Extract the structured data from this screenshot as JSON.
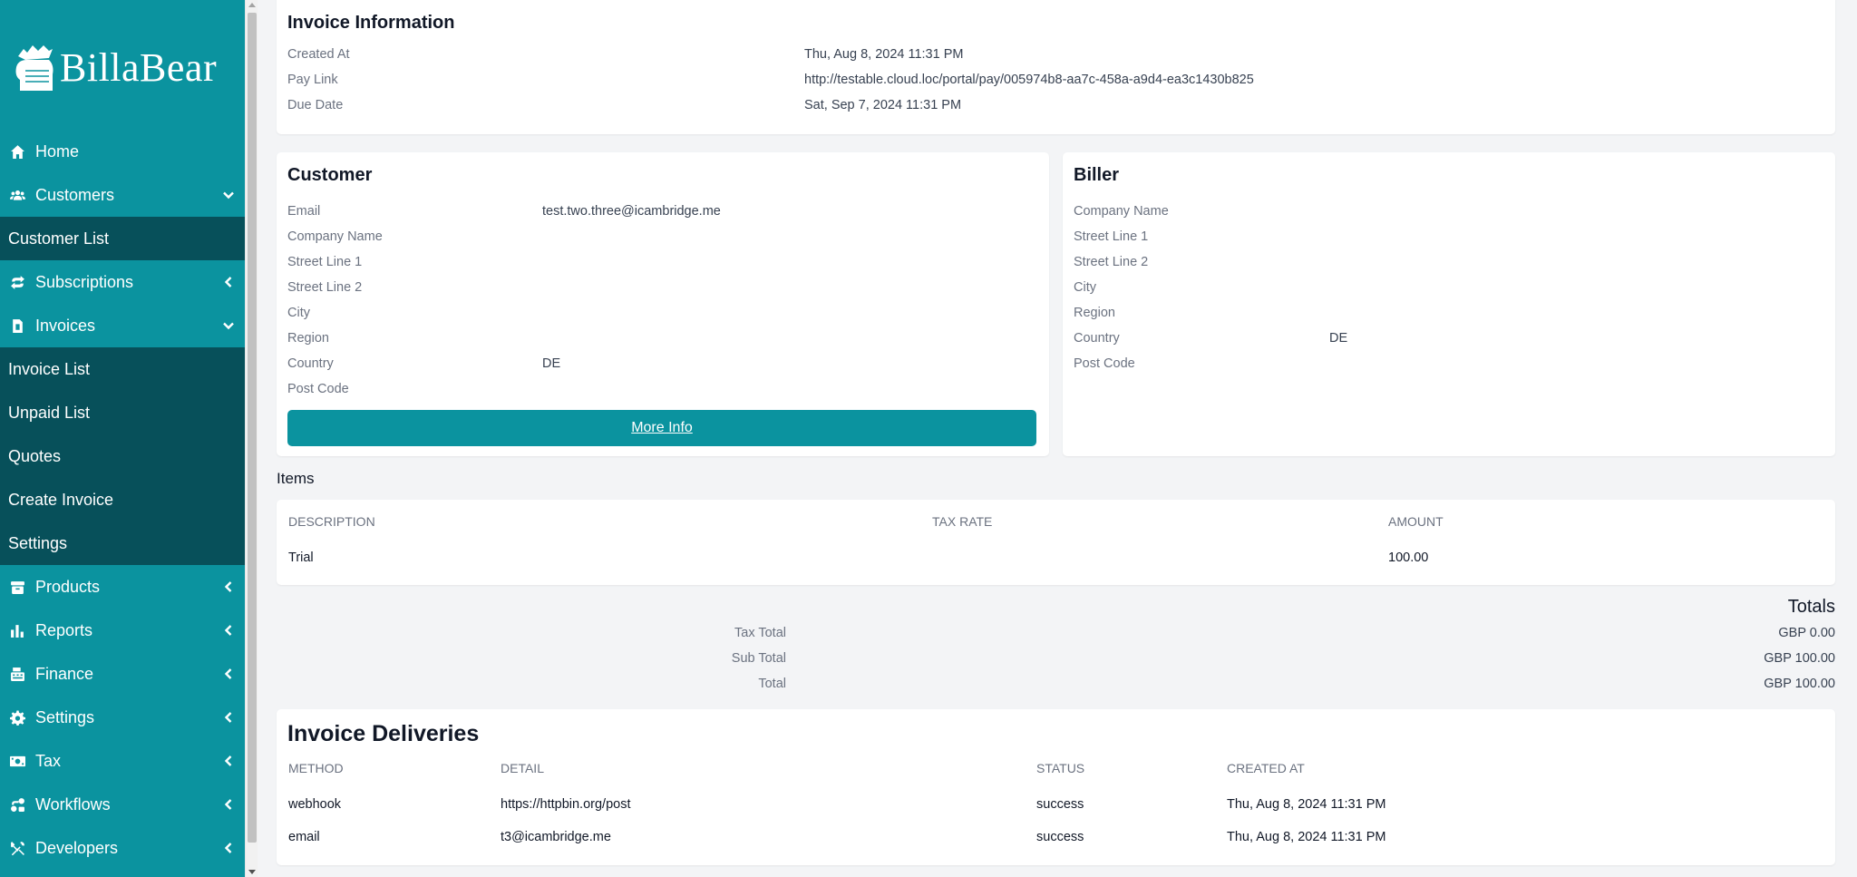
{
  "brand": {
    "name": "BillaBear"
  },
  "sidebar": {
    "home": "Home",
    "customers": "Customers",
    "customer_list": "Customer List",
    "subscriptions": "Subscriptions",
    "invoices": "Invoices",
    "invoice_list": "Invoice List",
    "unpaid_list": "Unpaid List",
    "quotes": "Quotes",
    "create_invoice": "Create Invoice",
    "invoice_settings": "Settings",
    "products": "Products",
    "reports": "Reports",
    "finance": "Finance",
    "settings": "Settings",
    "tax": "Tax",
    "workflows": "Workflows",
    "developers": "Developers"
  },
  "invoice_info": {
    "title": "Invoice Information",
    "created_at_label": "Created At",
    "created_at": "Thu, Aug 8, 2024 11:31 PM",
    "pay_link_label": "Pay Link",
    "pay_link": "http://testable.cloud.loc/portal/pay/005974b8-aa7c-458a-a9d4-ea3c1430b825",
    "due_date_label": "Due Date",
    "due_date": "Sat, Sep 7, 2024 11:31 PM"
  },
  "customer": {
    "title": "Customer",
    "email_label": "Email",
    "email": "test.two.three@icambridge.me",
    "company_name_label": "Company Name",
    "street1_label": "Street Line 1",
    "street2_label": "Street Line 2",
    "city_label": "City",
    "region_label": "Region",
    "country_label": "Country",
    "country": "DE",
    "post_code_label": "Post Code",
    "more_info": "More Info"
  },
  "biller": {
    "title": "Biller",
    "company_name_label": "Company Name",
    "street1_label": "Street Line 1",
    "street2_label": "Street Line 2",
    "city_label": "City",
    "region_label": "Region",
    "country_label": "Country",
    "country": "DE",
    "post_code_label": "Post Code"
  },
  "items": {
    "title": "Items",
    "headers": {
      "description": "Description",
      "tax_rate": "Tax Rate",
      "amount": "Amount"
    },
    "rows": [
      {
        "description": "Trial",
        "tax_rate": "",
        "amount": "100.00"
      }
    ]
  },
  "totals": {
    "title": "Totals",
    "tax_total_label": "Tax Total",
    "tax_total": "GBP 0.00",
    "sub_total_label": "Sub Total",
    "sub_total": "GBP 100.00",
    "total_label": "Total",
    "total": "GBP 100.00"
  },
  "deliveries": {
    "title": "Invoice Deliveries",
    "headers": {
      "method": "Method",
      "detail": "Detail",
      "status": "Status",
      "created_at": "Created At"
    },
    "rows": [
      {
        "method": "webhook",
        "detail": "https://httpbin.org/post",
        "status": "success",
        "created_at": "Thu, Aug 8, 2024 11:31 PM"
      },
      {
        "method": "email",
        "detail": "t3@icambridge.me",
        "status": "success",
        "created_at": "Thu, Aug 8, 2024 11:31 PM"
      }
    ]
  },
  "colors": {
    "brand": "#0b939f",
    "submenu": "#07505a",
    "background": "#f3f4f6"
  }
}
